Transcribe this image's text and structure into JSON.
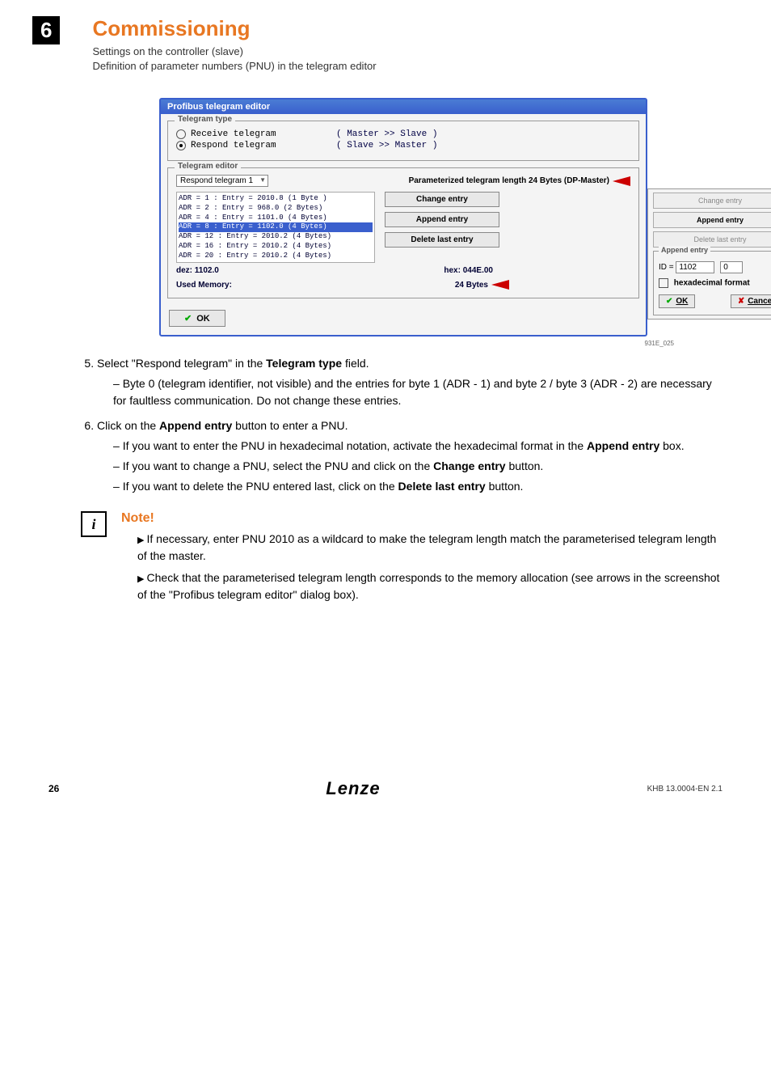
{
  "header": {
    "chapter": "6",
    "title": "Commissioning",
    "sub1": "Settings on the controller (slave)",
    "sub2": "Definition of parameter numbers (PNU) in the telegram editor"
  },
  "screenshot": {
    "windowTitle": "Profibus telegram editor",
    "grp_type": "Telegram type",
    "radio1": "Receive telegram",
    "radio1_hint": "( Master >> Slave )",
    "radio2": "Respond telegram",
    "radio2_hint": "( Slave >> Master )",
    "grp_editor": "Telegram editor",
    "combo": "Respond telegram 1",
    "param_len": "Parameterized telegram length 24 Bytes (DP-Master)",
    "lines": {
      "l1": "ADR =  1 : Entry =  2010.8  (1 Byte )",
      "l2": "ADR =  2 : Entry =   968.0  (2 Bytes)",
      "l3": "ADR =  4 : Entry =  1101.0  (4 Bytes)",
      "l4": "ADR =  8 : Entry =  1102.0  (4 Bytes)",
      "l5": "ADR = 12 : Entry =  2010.2  (4 Bytes)",
      "l6": "ADR = 16 : Entry =  2010.2  (4 Bytes)",
      "l7": "ADR = 20 : Entry =  2010.2  (4 Bytes)"
    },
    "btn_change": "Change entry",
    "btn_append": "Append entry",
    "btn_delete": "Delete last entry",
    "dez": "dez: 1102.0",
    "hex": "hex: 044E.00",
    "used_mem_lbl": "Used Memory:",
    "used_mem_val": "24 Bytes",
    "ok": "OK",
    "side": {
      "change": "Change entry",
      "append": "Append entry",
      "delete": "Delete last entry",
      "grp": "Append entry",
      "id_lbl": "ID = ",
      "id_val": "1102",
      "id_sub": "0",
      "hexfmt": "hexadecimal format",
      "okbtn": "OK",
      "cancel": "Cancel"
    },
    "caption": "931E_025"
  },
  "step5": {
    "text": "Select \"Respond telegram\" in the ",
    "bold": "Telegram type",
    "text2": " field.",
    "sub1": "Byte 0 (telegram identifier, not visible) and the entries for byte 1 (ADR - 1) and byte 2 / byte 3 (ADR - 2) are necessary for faultless communication. Do not change these entries."
  },
  "step6": {
    "text": "Click on the ",
    "bold": "Append entry",
    "text2": " button to enter a PNU.",
    "sub1a": "If you want to enter the PNU in hexadecimal notation, activate the hexadecimal format in the ",
    "sub1b": "Append entry",
    "sub1c": " box.",
    "sub2a": "If you want to change a PNU, select the PNU and click on the ",
    "sub2b": "Change entry",
    "sub2c": " button.",
    "sub3a": "If you want to delete the PNU entered last, click on the ",
    "sub3b": "Delete last entry",
    "sub3c": " button."
  },
  "note": {
    "title": "Note!",
    "b1": "If necessary, enter PNU 2010 as a wildcard to make the telegram length match the parameterised telegram length of the master.",
    "b2": "Check that the parameterised telegram length corresponds to the memory allocation (see arrows in the screenshot of the \"Profibus telegram editor\" dialog box)."
  },
  "footer": {
    "page": "26",
    "logo": "Lenze",
    "doc": "KHB 13.0004-EN   2.1"
  }
}
